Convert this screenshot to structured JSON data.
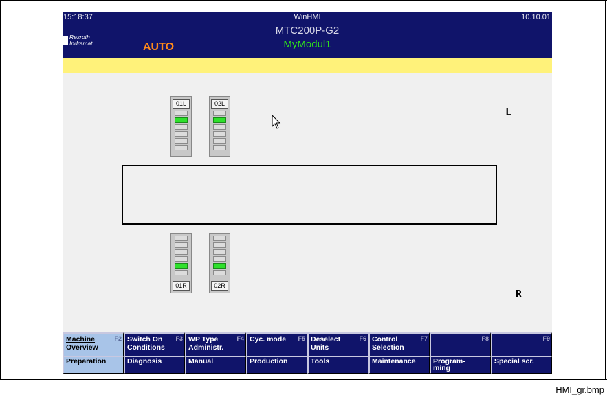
{
  "header": {
    "time": "15:18:37",
    "app_title": "WinHMI",
    "date": "10.10.01",
    "machine": "MTC200P-G2",
    "module": "MyModul1",
    "mode": "AUTO",
    "logo_line1": "Rexroth",
    "logo_line2": "Indramat"
  },
  "work": {
    "side_top": "L",
    "side_bottom": "R",
    "slots_top": [
      {
        "tag": "01L",
        "active_level": 2
      },
      {
        "tag": "02L",
        "active_level": 2
      }
    ],
    "slots_bottom": [
      {
        "tag": "01R",
        "active_level": 2
      },
      {
        "tag": "02R",
        "active_level": 2
      }
    ]
  },
  "softkeys_top": [
    {
      "line1": "Machine",
      "line2": "Overview",
      "fkey": "F2",
      "active": true
    },
    {
      "line1": "Switch On",
      "line2": "Conditions",
      "fkey": "F3",
      "active": false
    },
    {
      "line1": "WP Type",
      "line2": "Administr.",
      "fkey": "F4",
      "active": false
    },
    {
      "line1": "Cyc. mode",
      "line2": "",
      "fkey": "F5",
      "active": false
    },
    {
      "line1": "Deselect",
      "line2": "Units",
      "fkey": "F6",
      "active": false
    },
    {
      "line1": "Control",
      "line2": "Selection",
      "fkey": "F7",
      "active": false
    },
    {
      "line1": "",
      "line2": "",
      "fkey": "F8",
      "active": false
    },
    {
      "line1": "",
      "line2": "",
      "fkey": "F9",
      "active": false
    }
  ],
  "softkeys_bottom": [
    {
      "label": "Preparation",
      "active": true
    },
    {
      "label": "Diagnosis",
      "active": false
    },
    {
      "label": "Manual",
      "active": false
    },
    {
      "label": "Production",
      "active": false
    },
    {
      "label": "Tools",
      "active": false
    },
    {
      "label": "Maintenance",
      "active": false
    },
    {
      "label": "Program-\nming",
      "active": false
    },
    {
      "label": "Special scr.",
      "active": false
    }
  ],
  "caption": "HMI_gr.bmp",
  "colors": {
    "header_bg": "#10146a",
    "mode_text": "#ff8a1a",
    "module_text": "#2fe01c",
    "status_bar": "#fff27a",
    "segment_on": "#2fe02c",
    "key_active": "#a8c4e8"
  }
}
